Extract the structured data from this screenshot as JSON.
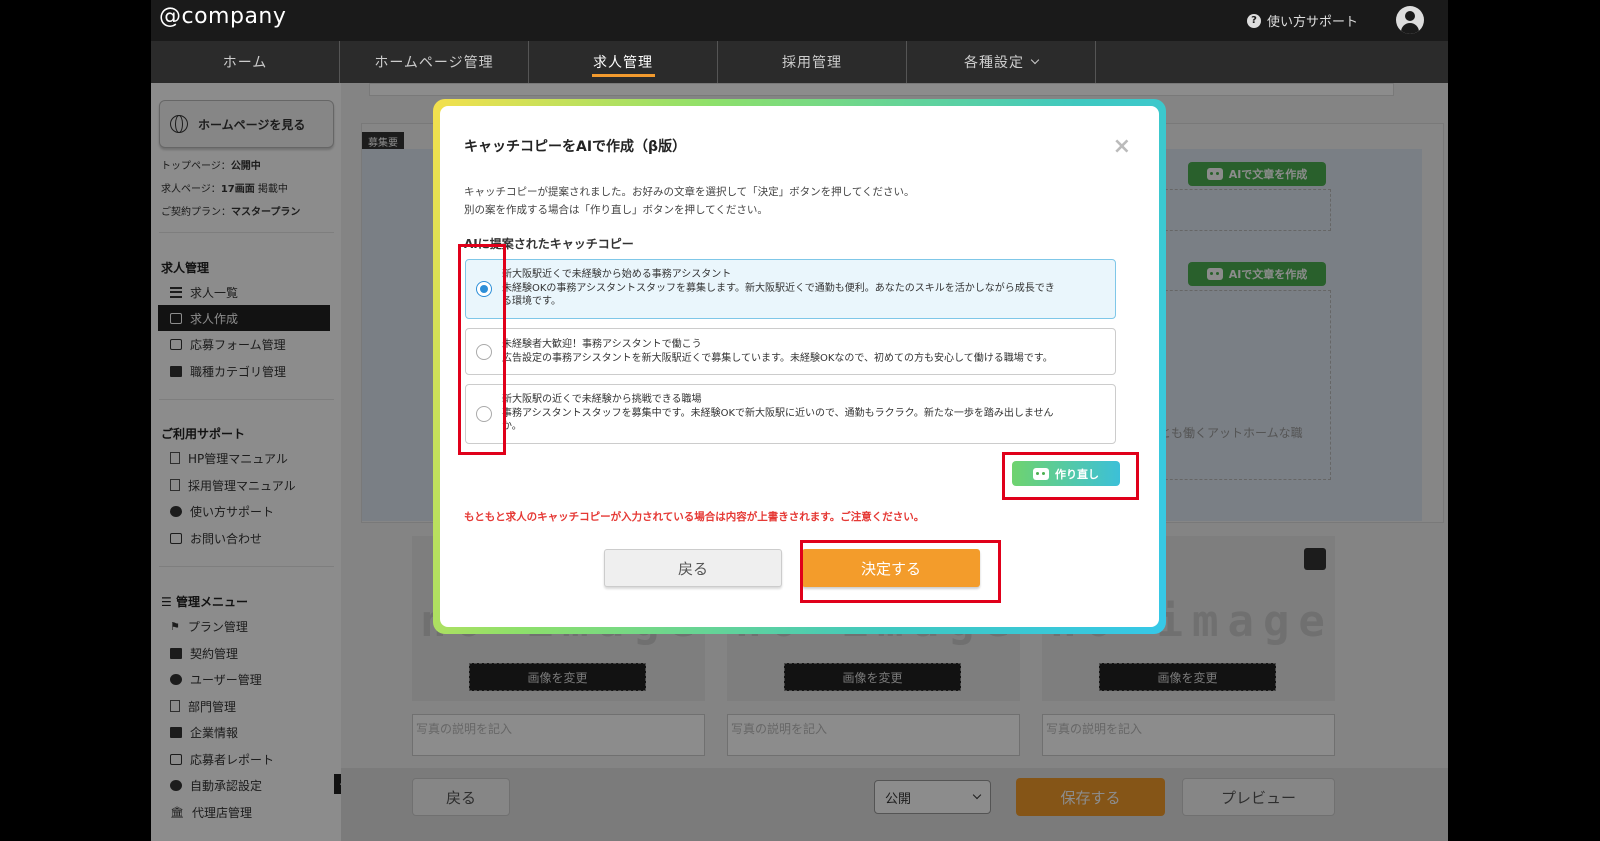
{
  "header": {
    "logo": "@company",
    "support": "使い方サポート"
  },
  "nav": {
    "tabs": [
      {
        "label": "ホーム"
      },
      {
        "label": "ホームページ管理"
      },
      {
        "label": "求人管理"
      },
      {
        "label": "採用管理"
      },
      {
        "label": "各種設定"
      }
    ]
  },
  "sidebar": {
    "hp_button": "ホームページを見る",
    "info": [
      {
        "label": "トップページ：",
        "value": "公開中",
        "suffix": ""
      },
      {
        "label": "求人ページ：",
        "value": "17画面",
        "suffix": " 掲載中"
      },
      {
        "label": "ご契約プラン：",
        "value": "マスタープラン",
        "suffix": ""
      }
    ],
    "job_section": "求人管理",
    "job_items": [
      "求人一覧",
      "求人作成",
      "応募フォーム管理",
      "職種カテゴリ管理"
    ],
    "support_section": "ご利用サポート",
    "support_items": [
      "HP管理マニュアル",
      "採用管理マニュアル",
      "使い方サポート",
      "お問い合わせ"
    ],
    "admin_section": "管理メニュー",
    "admin_items": [
      "プラン管理",
      "契約管理",
      "ユーザー管理",
      "部門管理",
      "企業情報",
      "応募者レポート",
      "自動承認設定",
      "代理店管理"
    ]
  },
  "background": {
    "section_tag": "募集要",
    "ai_button": "AIで文章を作成",
    "partial_text": "とも働くアットホームな職",
    "no_image": "no image",
    "change_image": "画像を変更",
    "caption_placeholder": "写真の説明を記入",
    "bottom": {
      "back": "戻る",
      "status": "公開",
      "save": "保存する",
      "preview": "プレビュー"
    }
  },
  "modal": {
    "title": "キャッチコピーをAIで作成（β版）",
    "close": "×",
    "desc1": "キャッチコピーが提案されました。お好みの文章を選択して「決定」ボタンを押してください。",
    "desc2": "別の案を作成する場合は「作り直し」ボタンを押してください。",
    "subtitle": "AIに提案されたキャッチコピー",
    "options": [
      {
        "line1": "新大阪駅近くで未経験から始める事務アシスタント",
        "line2": "未経験OKの事務アシスタントスタッフを募集します。新大阪駅近くで通勤も便利。あなたのスキルを活かしながら成長でき",
        "line3": "る環境です。",
        "selected": true
      },
      {
        "line1": "未経験者大歓迎！事務アシスタントで働こう",
        "line2": "広告設定の事務アシスタントを新大阪駅近くで募集しています。未経験OKなので、初めての方も安心して働ける職場です。",
        "line3": "",
        "selected": false
      },
      {
        "line1": "新大阪駅の近くで未経験から挑戦できる職場",
        "line2": "事務アシスタントスタッフを募集中です。未経験OKで新大阪駅に近いので、通勤もラクラク。新たな一歩を踏み出しません",
        "line3": "か。",
        "selected": false
      }
    ],
    "regenerate": "作り直し",
    "warning": "もともと求人のキャッチコピーが入力されている場合は内容が上書きされます。ご注意ください。",
    "back": "戻る",
    "decide": "決定する"
  },
  "colors": {
    "accent": "#f39c2b",
    "highlight": "#e0001a",
    "selected_radio": "#2e8fd8",
    "warning": "#e53935"
  }
}
